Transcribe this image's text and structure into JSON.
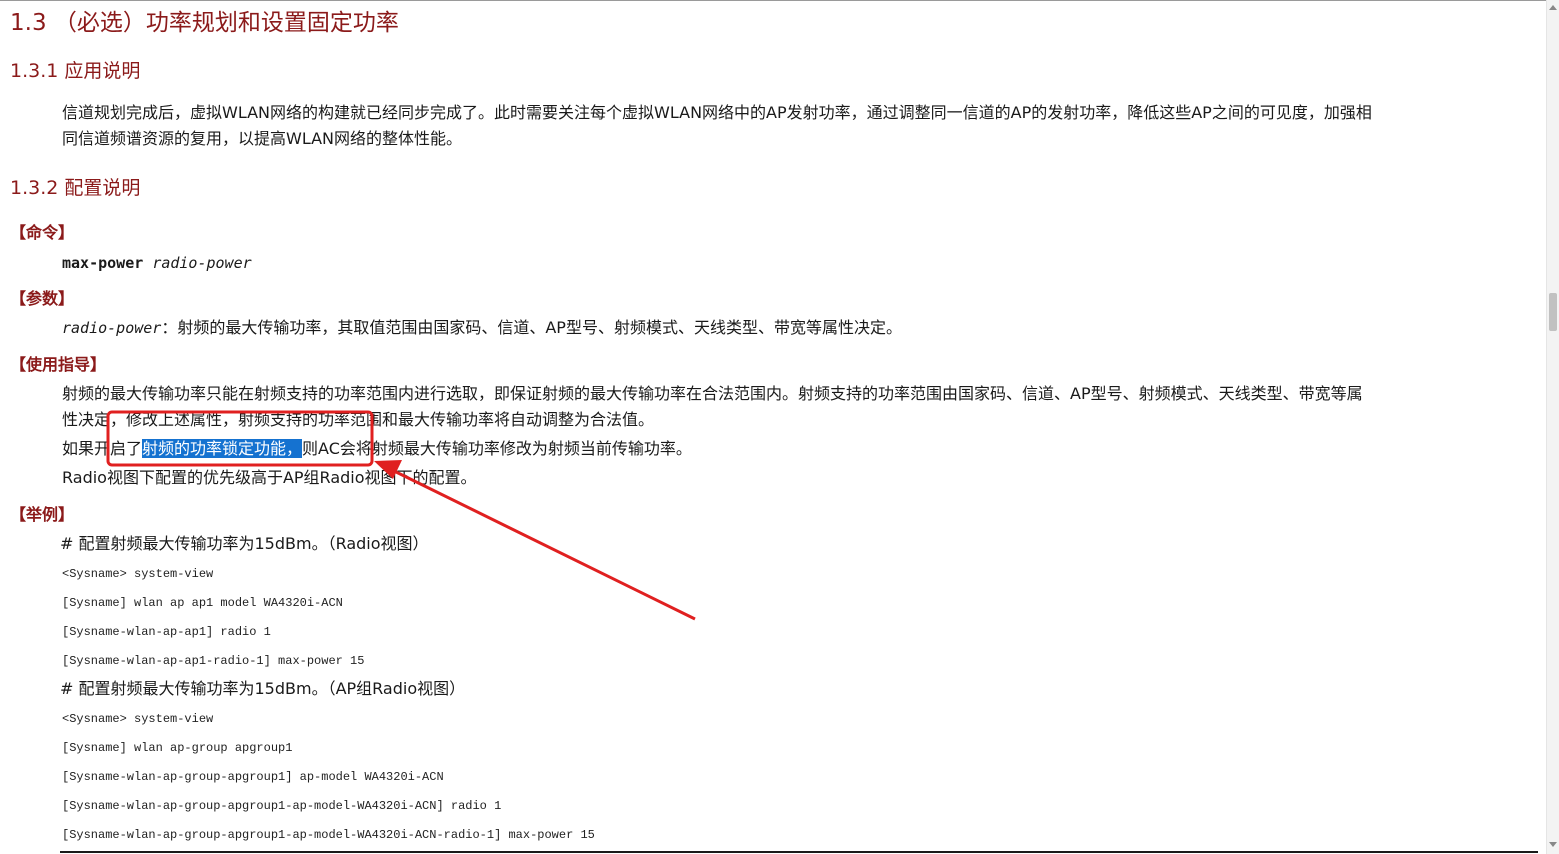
{
  "heading": {
    "section": "1.3 （必选）功率规划和设置固定功率",
    "sub1": "1.3.1  应用说明",
    "sub2": "1.3.2  配置说明"
  },
  "intro": {
    "line1": "信道规划完成后，虚拟WLAN网络的构建就已经同步完成了。此时需要关注每个虚拟WLAN网络中的AP发射功率，通过调整同一信道的AP的发射功率，降低这些AP之间的可见度，加强相",
    "line2": "同信道频谱资源的复用，以提高WLAN网络的整体性能。"
  },
  "command": {
    "label": "【命令】",
    "keyword": "max-power",
    "arg": "radio-power"
  },
  "params": {
    "label": "【参数】",
    "arg": "radio-power",
    "desc": "：射频的最大传输功率，其取值范围由国家码、信道、AP型号、射频模式、天线类型、带宽等属性决定。"
  },
  "usage": {
    "label": "【使用指导】",
    "line1": "射频的最大传输功率只能在射频支持的功率范围内进行选取，即保证射频的最大传输功率在合法范围内。射频支持的功率范围由国家码、信道、AP型号、射频模式、天线类型、带宽等属",
    "line2": "性决定，修改上述属性，射频支持的功率范围和最大传输功率将自动调整为合法值。",
    "line3_pre": "如果开启了",
    "line3_highlight": "射频的功率锁定功能，",
    "line3_post": "则AC会将射频最大传输功率修改为射频当前传输功率。",
    "line4": "Radio视图下配置的优先级高于AP组Radio视图下的配置。"
  },
  "example": {
    "label": "【举例】",
    "head1": "# 配置射频最大传输功率为15dBm。（Radio视图）",
    "code1": [
      "<Sysname> system-view",
      "[Sysname] wlan ap ap1 model WA4320i-ACN",
      "[Sysname-wlan-ap-ap1] radio 1",
      "[Sysname-wlan-ap-ap1-radio-1] max-power 15"
    ],
    "head2": "# 配置射频最大传输功率为15dBm。（AP组Radio视图）",
    "code2": [
      "<Sysname> system-view",
      "[Sysname] wlan ap-group apgroup1",
      "[Sysname-wlan-ap-group-apgroup1] ap-model WA4320i-ACN",
      "[Sysname-wlan-ap-group-apgroup1-ap-model-WA4320i-ACN] radio 1",
      "[Sysname-wlan-ap-group-apgroup1-ap-model-WA4320i-ACN-radio-1] max-power 15"
    ]
  },
  "colors": {
    "heading": "#8b1a1a",
    "highlight_bg": "#1572d0",
    "annotation": "#e02020"
  }
}
